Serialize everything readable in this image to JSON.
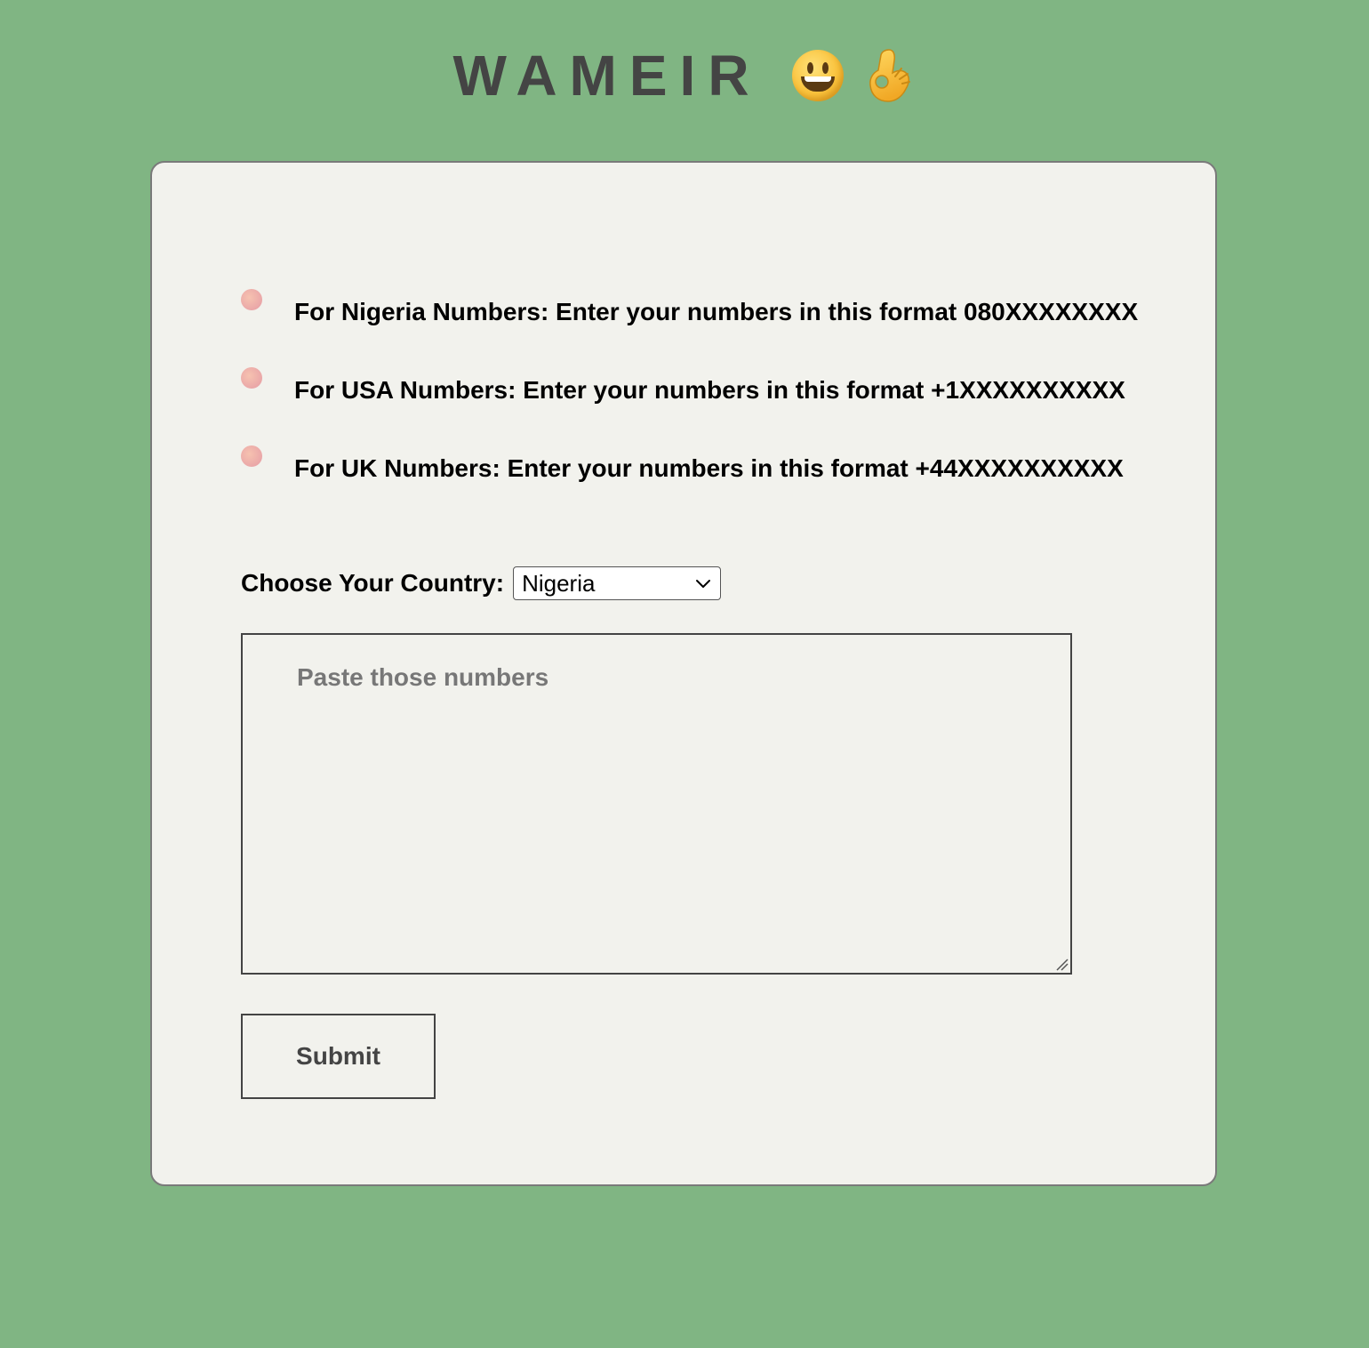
{
  "header": {
    "brand": "WAMEIR",
    "emojis": [
      "grinning-face-icon",
      "ok-hand-icon"
    ]
  },
  "instructions": [
    {
      "text": "For Nigeria Numbers: Enter your numbers in this format 080XXXXXXXX"
    },
    {
      "text": "For USA Numbers: Enter your numbers in this format +1XXXXXXXXXX"
    },
    {
      "text": "For UK Numbers: Enter your numbers in this format +44XXXXXXXXXX"
    }
  ],
  "country": {
    "label": "Choose Your Country:",
    "selected": "Nigeria"
  },
  "numbers": {
    "value": "",
    "placeholder": "Paste those numbers"
  },
  "submit": {
    "label": "Submit"
  },
  "colors": {
    "page_background": "#80b583",
    "card_background": "#f2f2ed",
    "brand_text": "#444444",
    "bullet": "#eaa7a8",
    "placeholder_text": "#777777"
  }
}
